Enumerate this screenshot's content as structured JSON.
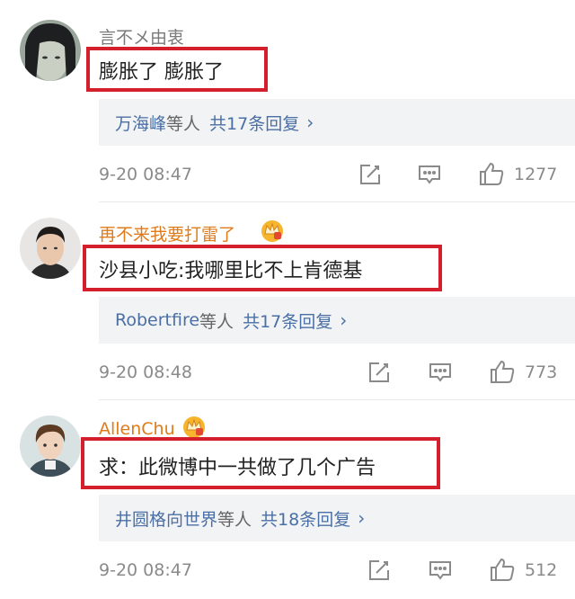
{
  "comments": [
    {
      "username": "言不メ由衷",
      "username_color": "#7a7a7a",
      "text": "膨胀了 膨胀了",
      "reply_names": "万海峰",
      "reply_suffix": "等人",
      "reply_count": "共17条回复",
      "reply_chevron": "›",
      "time": "9-20 08:47",
      "likes": "1277",
      "has_badge": false
    },
    {
      "username": "再不来我要打雷了",
      "username_color": "#e07b1a",
      "text": "沙县小吃:我哪里比不上肯德基",
      "reply_names": "Robertfire",
      "reply_suffix": "等人",
      "reply_count": "共17条回复",
      "reply_chevron": "›",
      "time": "9-20 08:48",
      "likes": "773",
      "has_badge": true
    },
    {
      "username": "AllenChu",
      "username_color": "#e07b1a",
      "text": "求：此微博中一共做了几个广告",
      "reply_names": "井圆格向世界",
      "reply_suffix": "等人",
      "reply_count": "共18条回复",
      "reply_chevron": "›",
      "time": "9-20 08:47",
      "likes": "512",
      "has_badge": true
    }
  ],
  "icons": {
    "edit": "edit-icon",
    "comment": "comment-icon",
    "like": "thumbs-up-icon",
    "badge": "crown-badge-icon"
  },
  "colors": {
    "highlight_box": "#d3202c",
    "link": "#4a6fa5",
    "vip_name": "#e07b1a"
  }
}
